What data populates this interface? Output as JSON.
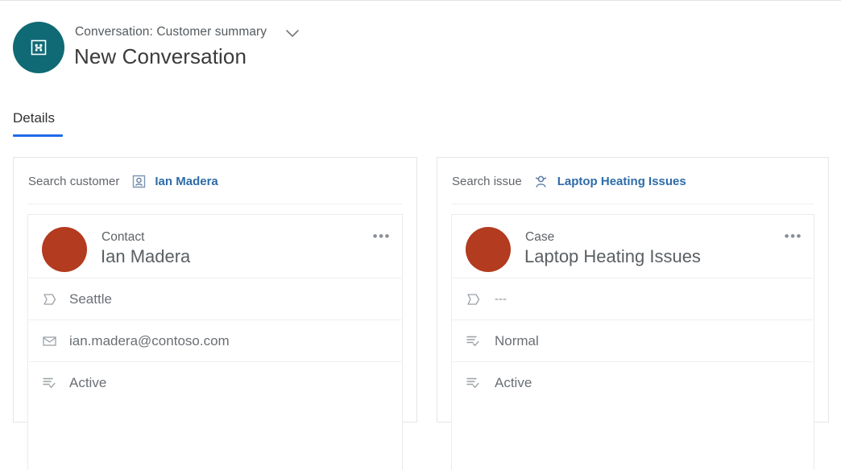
{
  "header": {
    "entity_icon": "conversation-icon",
    "breadcrumb": "Conversation: Customer summary",
    "chevron": "chevron-down-icon",
    "title": "New Conversation",
    "accent_color": "#0f6a75"
  },
  "tabs": [
    {
      "label": "Details",
      "selected": true,
      "underline_color": "#1f6bec"
    }
  ],
  "cards": [
    {
      "search": {
        "label": "Search customer",
        "entity_icon": "contact-card-icon",
        "entity_name": "Ian Madera",
        "link_color": "#2d6ca8"
      },
      "record": {
        "avatar_color": "#b33b1f",
        "type": "Contact",
        "name": "Ian Madera",
        "overflow_label": "•••",
        "fields": [
          {
            "icon": "location-tag-icon",
            "value": "Seattle"
          },
          {
            "icon": "email-icon",
            "value": "ian.madera@contoso.com"
          },
          {
            "icon": "status-list-icon",
            "value": "Active"
          }
        ]
      }
    },
    {
      "search": {
        "label": "Search issue",
        "entity_icon": "case-person-icon",
        "entity_name": "Laptop Heating Issues",
        "link_color": "#2d6ca8"
      },
      "record": {
        "avatar_color": "#b33b1f",
        "type": "Case",
        "name": "Laptop Heating Issues",
        "overflow_label": "•••",
        "fields": [
          {
            "icon": "location-tag-icon",
            "value": "---"
          },
          {
            "icon": "status-list-icon",
            "value": "Normal"
          },
          {
            "icon": "status-list-icon",
            "value": "Active"
          }
        ]
      }
    }
  ]
}
